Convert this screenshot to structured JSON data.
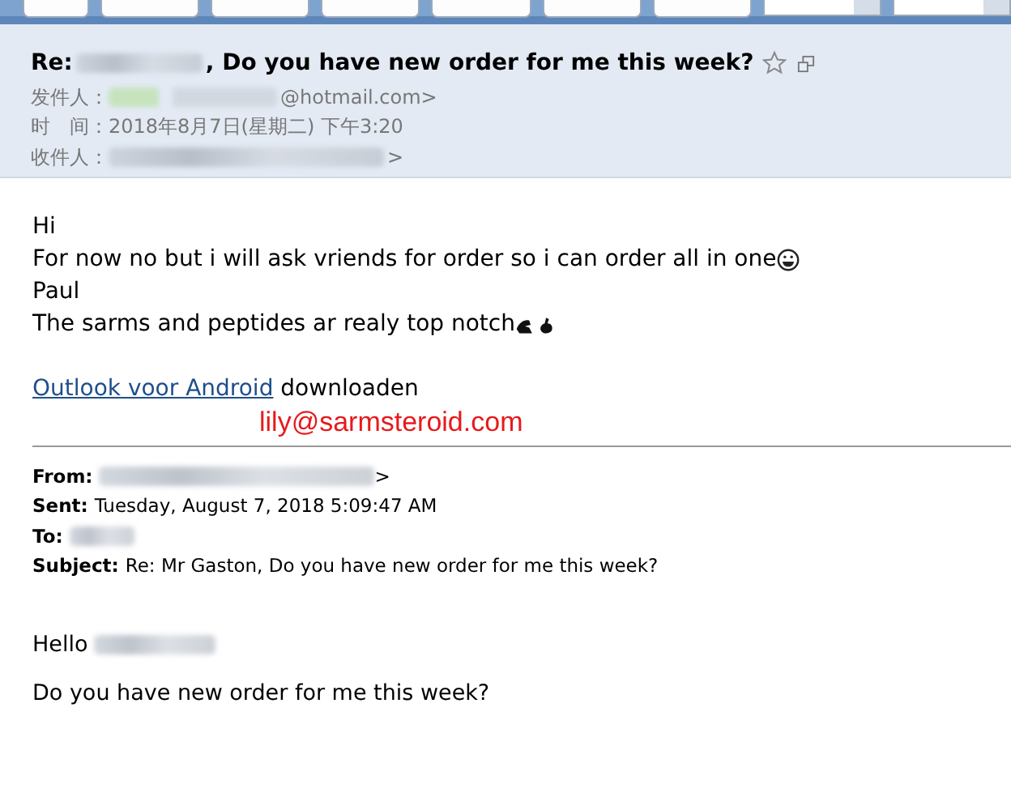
{
  "toolbar": [
    {
      "kind": "button"
    },
    {
      "kind": "button"
    },
    {
      "kind": "button"
    },
    {
      "kind": "button"
    },
    {
      "kind": "button"
    },
    {
      "kind": "button"
    },
    {
      "kind": "button"
    },
    {
      "kind": "dropdown"
    },
    {
      "kind": "dropdown"
    }
  ],
  "header": {
    "subject_prefix": "Re:",
    "subject_redacted": true,
    "subject_rest": ", Do you have new order for me this week?",
    "starred": false,
    "fields": [
      {
        "label": "发件人：",
        "redacted": true,
        "value": "@hotmail.com>"
      },
      {
        "label": "时　间：",
        "redacted": false,
        "value": "2018年8月7日(星期二) 下午3:20"
      },
      {
        "label": "收件人：",
        "redacted": true,
        "value": ">"
      }
    ]
  },
  "body": {
    "greeting": "Hi",
    "lines": [
      "For now no but i will ask vriends for order so i can order all in one",
      "Paul",
      "The sarms and peptides ar realy top notch"
    ],
    "link": "Outlook voor Android",
    "link_after": " downloaden",
    "stamp": "lily@sarmsteroid.com"
  },
  "quoted": {
    "fields": [
      {
        "label": "From:",
        "redacted": true,
        "value": ">"
      },
      {
        "label": "Sent:",
        "redacted": false,
        "value": "Tuesday, August 7, 2018 5:09:47 AM"
      },
      {
        "label": "To:",
        "redacted": true
      },
      {
        "label": "Subject:",
        "redacted": false,
        "value": "Re: Mr Gaston, Do you have new order for me this week?"
      }
    ],
    "greeting": "Hello",
    "greeting_redacted": true,
    "text": "Do you have new order for me this week?"
  }
}
